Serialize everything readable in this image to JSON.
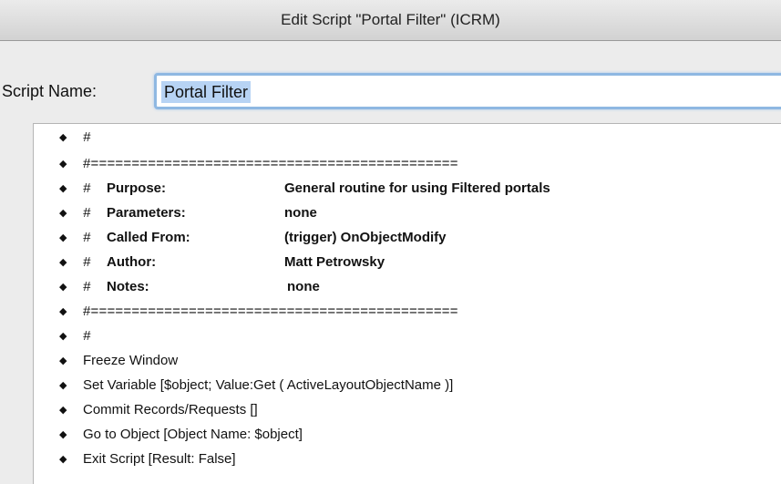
{
  "window": {
    "title": "Edit Script \"Portal Filter\" (ICRM)"
  },
  "script_name": {
    "label": "Script Name:",
    "value": "Portal Filter"
  },
  "steps": [
    {
      "text": "#"
    },
    {
      "text": "#============================================="
    },
    {
      "key": "Purpose:",
      "value": "General routine for using Filtered portals"
    },
    {
      "key": "Parameters:",
      "value": "none"
    },
    {
      "key": "Called From:",
      "value": "(trigger) OnObjectModify"
    },
    {
      "key": "Author:",
      "value": "Matt Petrowsky"
    },
    {
      "key": "Notes:",
      "value": "none"
    },
    {
      "text": "#============================================="
    },
    {
      "text": "#"
    },
    {
      "text": "Freeze Window"
    },
    {
      "text": "Set Variable [$object; Value:Get ( ActiveLayoutObjectName )]"
    },
    {
      "text": "Commit Records/Requests []"
    },
    {
      "text": "Go to Object [Object Name: $object]"
    },
    {
      "text": "Exit Script [Result: False]"
    }
  ],
  "icons": {
    "step_handle": "updown-arrows-icon"
  }
}
